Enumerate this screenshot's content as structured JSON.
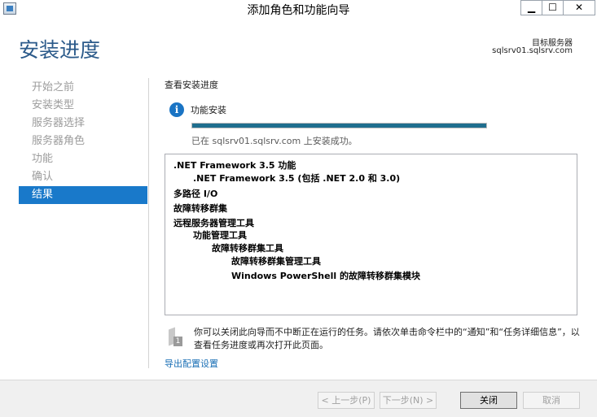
{
  "window": {
    "title": "添加角色和功能向导",
    "minimize": "▁",
    "maximize": "☐",
    "close": "✕"
  },
  "header": {
    "title": "安装进度",
    "server_label": "目标服务器",
    "server_name": "sqlsrv01.sqlsrv.com"
  },
  "nav": {
    "items": [
      {
        "label": "开始之前"
      },
      {
        "label": "安装类型"
      },
      {
        "label": "服务器选择"
      },
      {
        "label": "服务器角色"
      },
      {
        "label": "功能"
      },
      {
        "label": "确认"
      },
      {
        "label": "结果"
      }
    ],
    "active_index": 6
  },
  "content": {
    "section_title": "查看安装进度",
    "info_icon": "i",
    "info_label": "功能安装",
    "progress_percent": 100,
    "success_text": "已在 sqlsrv01.sqlsrv.com 上安装成功。",
    "results": [
      ".NET Framework 3.5 功能",
      ".NET Framework 3.5 (包括 .NET 2.0 和 3.0)",
      "多路径 I/O",
      "故障转移群集",
      "远程服务器管理工具",
      "功能管理工具",
      "故障转移群集工具",
      "故障转移群集管理工具",
      "Windows PowerShell 的故障转移群集模块"
    ],
    "note_icon_number": "1",
    "note_text": "你可以关闭此向导而不中断正在运行的任务。请依次单击命令栏中的“通知”和“任务详细信息”，以查看任务进度或再次打开此页面。",
    "export_link": "导出配置设置"
  },
  "footer": {
    "prev": "< 上一步(P)",
    "next": "下一步(N) >",
    "close": "关闭",
    "cancel": "取消"
  }
}
